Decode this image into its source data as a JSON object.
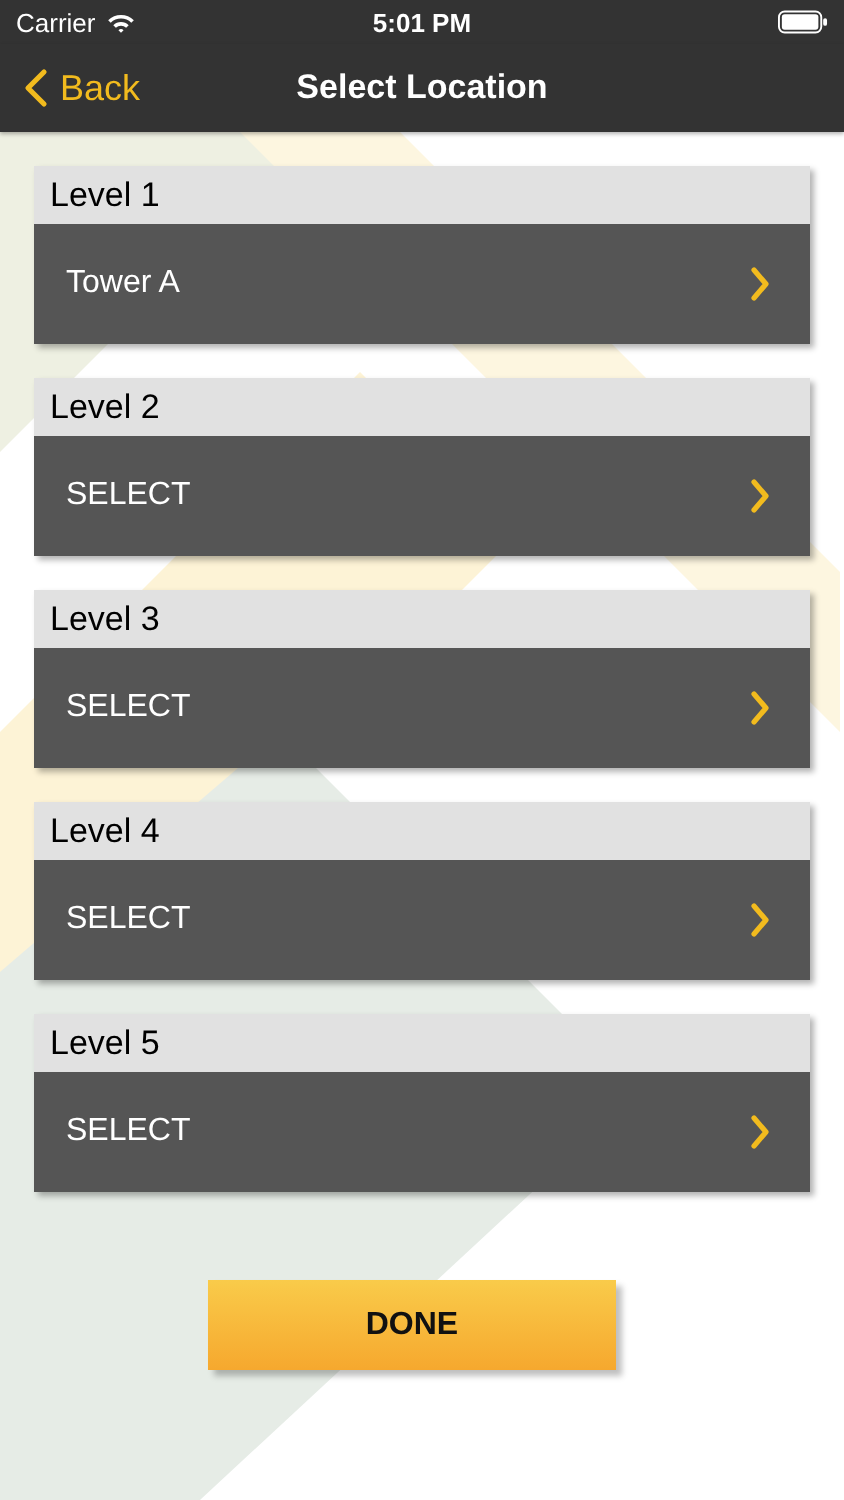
{
  "status_bar": {
    "carrier": "Carrier",
    "time": "5:01 PM"
  },
  "nav_bar": {
    "back": "Back",
    "title": "Select Location"
  },
  "levels": [
    {
      "label": "Level 1",
      "value": "Tower A"
    },
    {
      "label": "Level 2",
      "value": "SELECT"
    },
    {
      "label": "Level 3",
      "value": "SELECT"
    },
    {
      "label": "Level 4",
      "value": "SELECT"
    },
    {
      "label": "Level 5",
      "value": "SELECT"
    }
  ],
  "done_button": "DONE"
}
